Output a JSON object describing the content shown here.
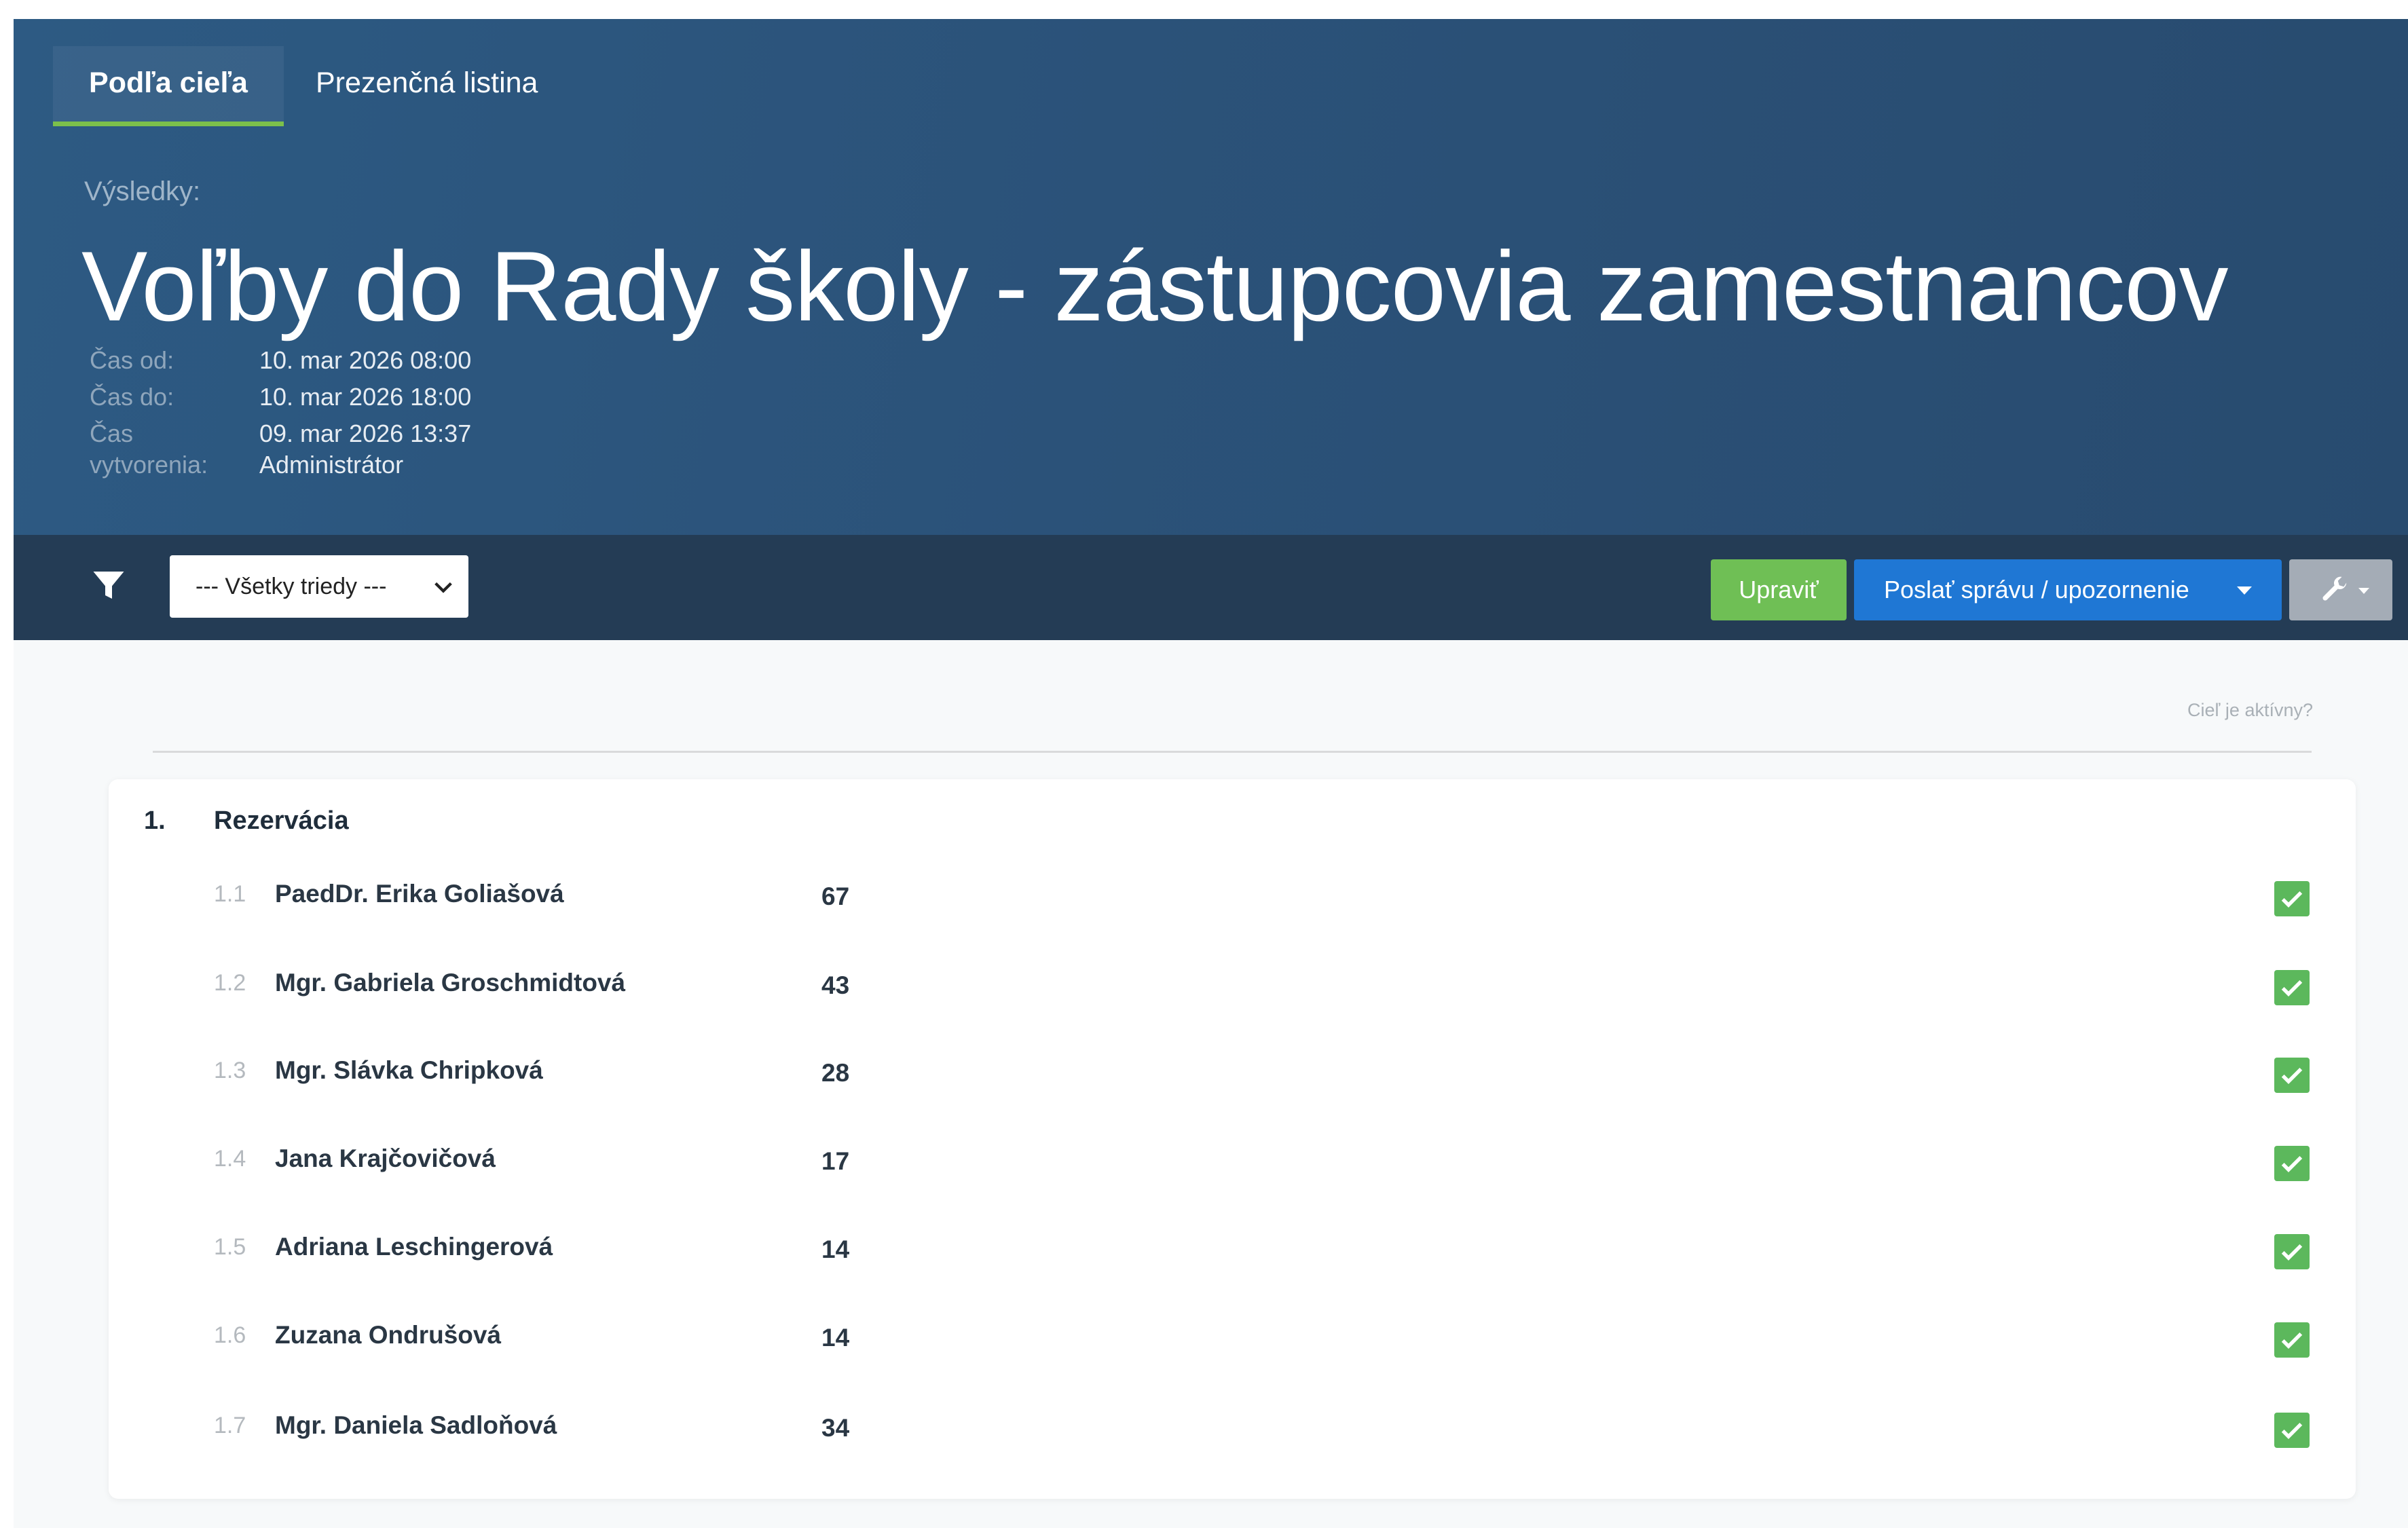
{
  "tabs": [
    {
      "label": "Podľa cieľa",
      "active": true
    },
    {
      "label": "Prezenčná listina",
      "active": false
    }
  ],
  "header": {
    "results_label": "Výsledky:",
    "title": "Voľby do Rady školy - zástupcovia zamestnancov",
    "meta": [
      {
        "label": "Čas od:",
        "value": "10. mar 2026 08:00"
      },
      {
        "label": "Čas do:",
        "value": "10. mar 2026 18:00"
      },
      {
        "label": "Čas vytvorenia:",
        "label_lines": [
          "Čas",
          "vytvorenia:"
        ],
        "value": "09. mar 2026 13:37",
        "value2": "Administrátor"
      }
    ]
  },
  "toolbar": {
    "filter_icon": "filter-icon",
    "class_select": {
      "selected": "--- Všetky triedy ---"
    },
    "edit_label": "Upraviť",
    "send_label": "Poslať správu / upozornenie",
    "tools_icon": "wrench-icon"
  },
  "content": {
    "active_question": "Cieľ je aktívny?",
    "section": {
      "number": "1.",
      "title": "Rezervácia",
      "rows": [
        {
          "num": "1.1",
          "name": "PaedDr. Erika Goliašová",
          "votes": "67",
          "active": true
        },
        {
          "num": "1.2",
          "name": "Mgr. Gabriela Groschmidtová",
          "votes": "43",
          "active": true
        },
        {
          "num": "1.3",
          "name": "Mgr. Slávka Chripková",
          "votes": "28",
          "active": true
        },
        {
          "num": "1.4",
          "name": "Jana Krajčovičová",
          "votes": "17",
          "active": true
        },
        {
          "num": "1.5",
          "name": "Adriana Leschingerová",
          "votes": "14",
          "active": true
        },
        {
          "num": "1.6",
          "name": "Zuzana Ondrušová",
          "votes": "14",
          "active": true
        },
        {
          "num": "1.7",
          "name": "Mgr. Daniela Sadloňová",
          "votes": "34",
          "active": true
        }
      ]
    }
  },
  "colors": {
    "header_bg": "#2b5279",
    "toolbar_bg": "#243c55",
    "tab_underline": "#7cc04b",
    "edit_button": "#6fbf55",
    "send_button": "#1f77d4",
    "tools_button": "#a4acb6",
    "check": "#5cb85c"
  }
}
